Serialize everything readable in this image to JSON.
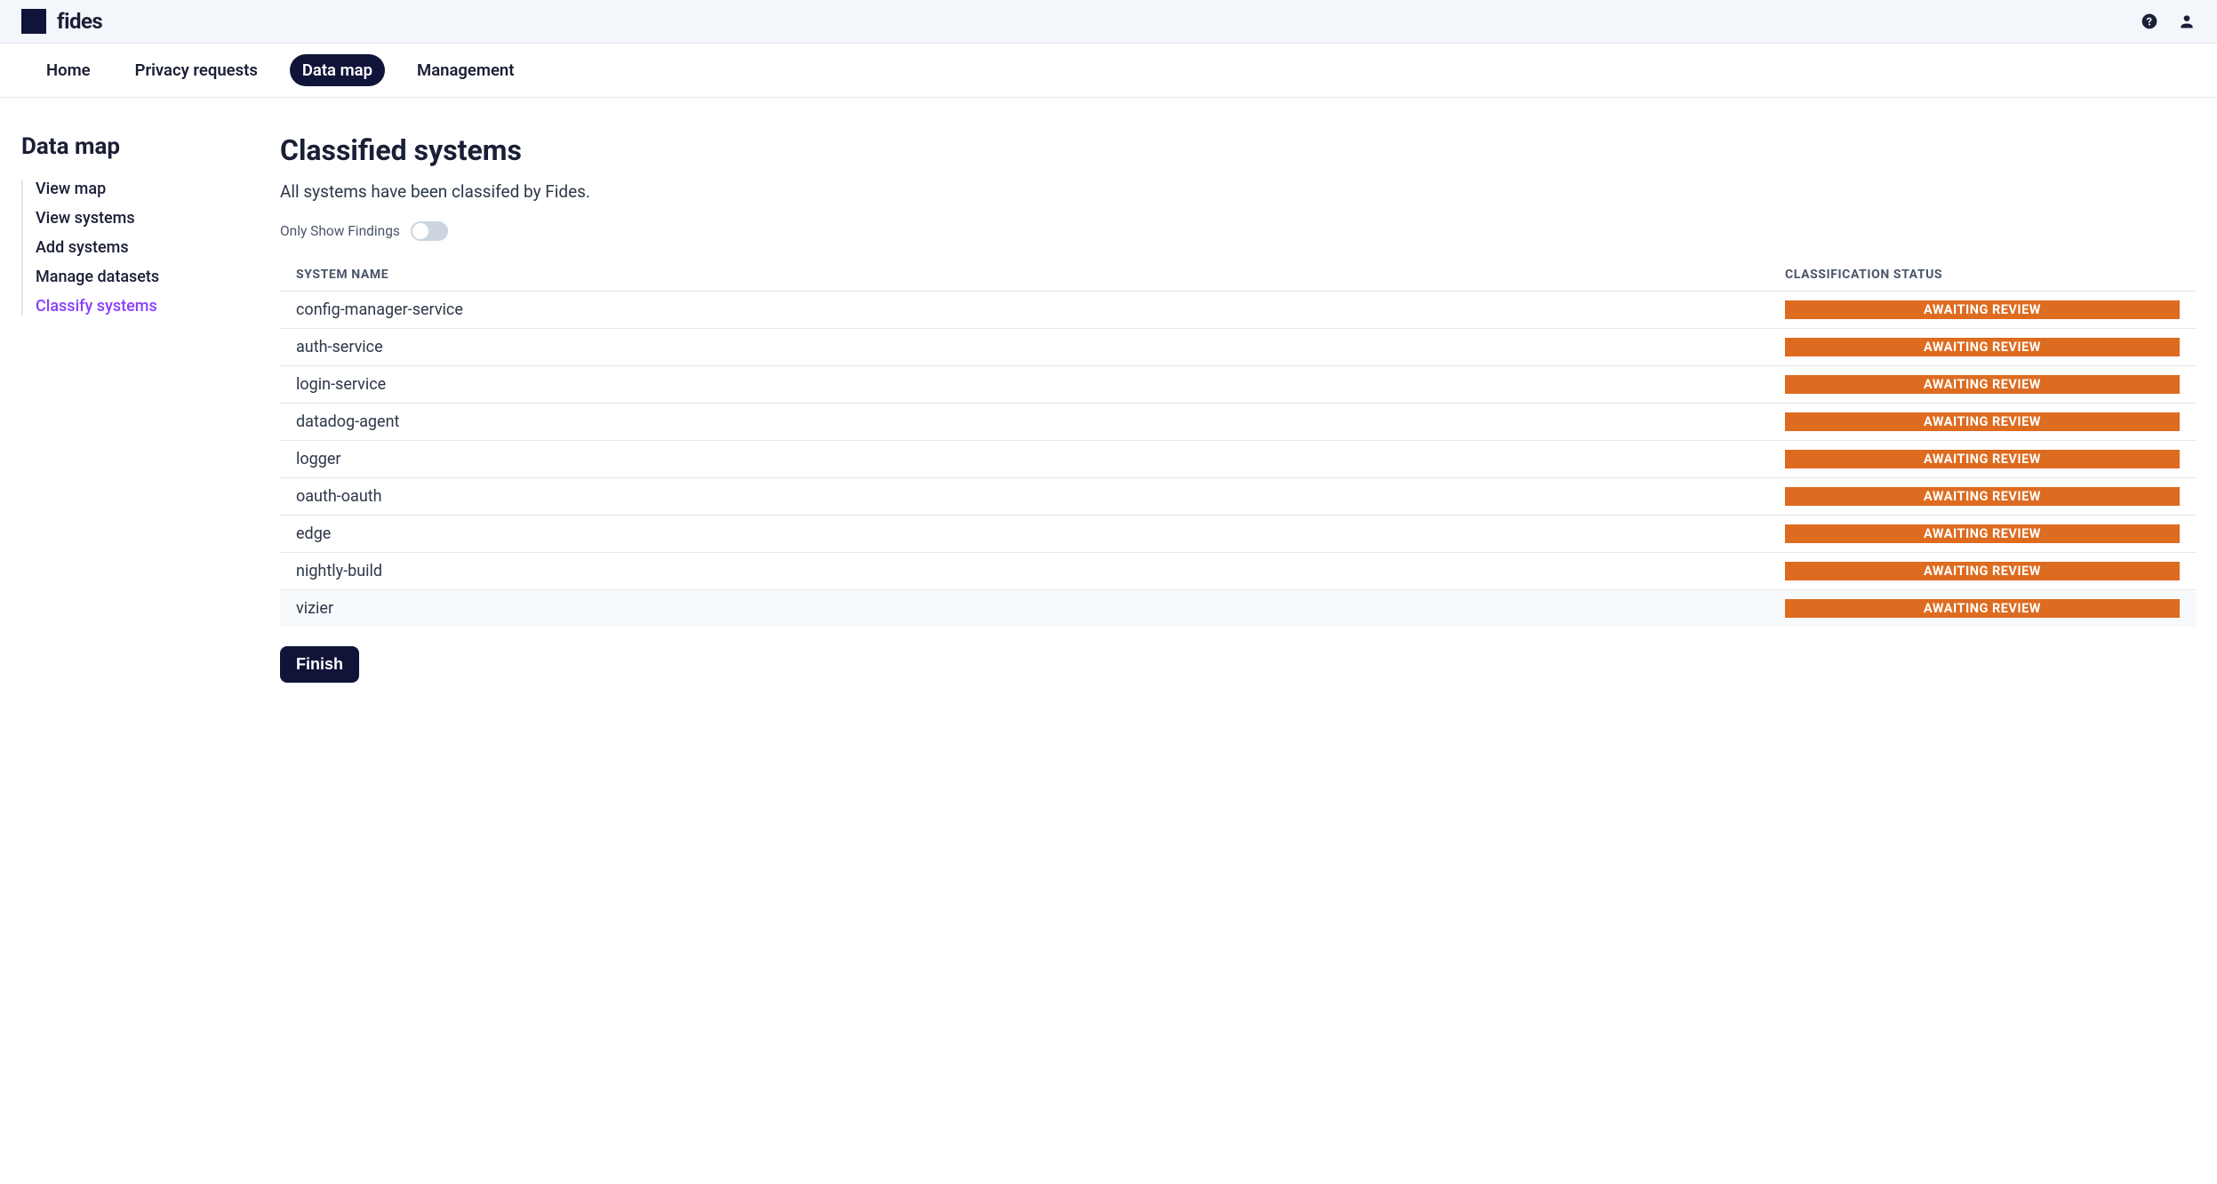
{
  "brand": {
    "name": "fides"
  },
  "topNav": {
    "items": [
      {
        "label": "Home",
        "active": false
      },
      {
        "label": "Privacy requests",
        "active": false
      },
      {
        "label": "Data map",
        "active": true
      },
      {
        "label": "Management",
        "active": false
      }
    ]
  },
  "sidebar": {
    "title": "Data map",
    "items": [
      {
        "label": "View map",
        "active": false
      },
      {
        "label": "View systems",
        "active": false
      },
      {
        "label": "Add systems",
        "active": false
      },
      {
        "label": "Manage datasets",
        "active": false
      },
      {
        "label": "Classify systems",
        "active": true
      }
    ]
  },
  "page": {
    "title": "Classified systems",
    "subtitle": "All systems have been classifed by Fides.",
    "toggle_label": "Only Show Findings",
    "toggle_on": false,
    "finish_label": "Finish"
  },
  "table": {
    "columns": {
      "name": "SYSTEM NAME",
      "status": "CLASSIFICATION STATUS"
    },
    "rows": [
      {
        "name": "config-manager-service",
        "status": "AWAITING REVIEW"
      },
      {
        "name": "auth-service",
        "status": "AWAITING REVIEW"
      },
      {
        "name": "login-service",
        "status": "AWAITING REVIEW"
      },
      {
        "name": "datadog-agent",
        "status": "AWAITING REVIEW"
      },
      {
        "name": "logger",
        "status": "AWAITING REVIEW"
      },
      {
        "name": "oauth-oauth",
        "status": "AWAITING REVIEW"
      },
      {
        "name": "edge",
        "status": "AWAITING REVIEW"
      },
      {
        "name": "nightly-build",
        "status": "AWAITING REVIEW"
      },
      {
        "name": "vizier",
        "status": "AWAITING REVIEW"
      }
    ]
  },
  "colors": {
    "accent": "#dd6b20",
    "primary_dark": "#111439",
    "active_link": "#8a3ffc"
  }
}
